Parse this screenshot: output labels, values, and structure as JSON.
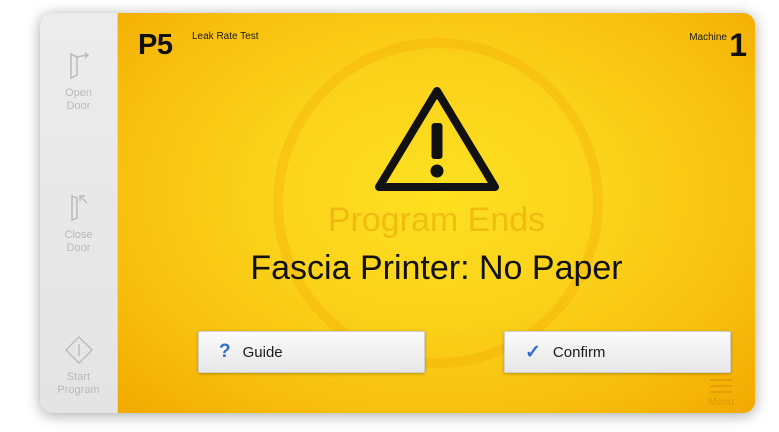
{
  "sidebar": {
    "open_door": "Open\nDoor",
    "close_door": "Close\nDoor",
    "start_program": "Start\nProgram"
  },
  "header": {
    "program_code": "P5",
    "program_name": "Leak Rate Test",
    "machine_label": "Machine",
    "machine_number": "1"
  },
  "background": {
    "status_text": "Program Ends"
  },
  "alert": {
    "icon": "warning-triangle-icon",
    "message": "Fascia Printer: No Paper"
  },
  "buttons": {
    "guide_glyph": "?",
    "guide_label": "Guide",
    "confirm_glyph": "✓",
    "confirm_label": "Confirm"
  },
  "menu": {
    "label": "Menu"
  },
  "colors": {
    "accent_blue": "#2f6fd0",
    "alert_yellow": "#fbd21a",
    "sidebar_gray": "#e8e8e8"
  }
}
